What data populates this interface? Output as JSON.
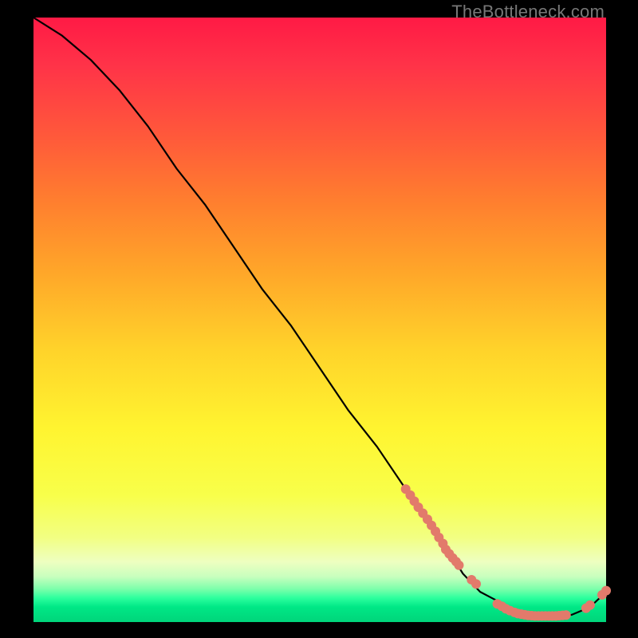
{
  "watermark": "TheBottleneck.com",
  "chart_data": {
    "type": "line",
    "title": "",
    "xlabel": "",
    "ylabel": "",
    "xlim": [
      0,
      100
    ],
    "ylim": [
      0,
      100
    ],
    "grid": false,
    "legend": false,
    "series": [
      {
        "name": "bottleneck-curve",
        "color": "#000000",
        "x": [
          0,
          5,
          10,
          15,
          20,
          25,
          30,
          35,
          40,
          45,
          50,
          55,
          60,
          65,
          67,
          70,
          73,
          75,
          78,
          80,
          83,
          85,
          88,
          90,
          92,
          94,
          96,
          98,
          100
        ],
        "y": [
          100,
          97,
          93,
          88,
          82,
          75,
          69,
          62,
          55,
          49,
          42,
          35,
          29,
          22,
          19,
          15,
          11,
          8,
          5,
          4,
          2.5,
          1.5,
          1,
          1,
          1,
          1.2,
          2,
          3.2,
          5
        ]
      }
    ],
    "markers": [
      {
        "name": "highlight-cluster-1",
        "color": "#e27a6b",
        "x": [
          65,
          65.8,
          66.5,
          67.2,
          68,
          68.8,
          69.5,
          70.2,
          70.8,
          71.5,
          72,
          72.6,
          73.2,
          73.8,
          74.3
        ],
        "y": [
          22,
          21,
          20,
          19,
          18,
          17,
          16,
          15,
          14,
          13,
          12,
          11.3,
          10.6,
          10,
          9.4
        ]
      },
      {
        "name": "highlight-cluster-2",
        "color": "#e27a6b",
        "x": [
          76.5,
          77.3
        ],
        "y": [
          7,
          6.3
        ]
      },
      {
        "name": "highlight-cluster-3",
        "color": "#e27a6b",
        "x": [
          81,
          81.8,
          82.5,
          83.2,
          84,
          84.6,
          85.2,
          85.8,
          86.4,
          87,
          87.6,
          88.2,
          88.8,
          89.4,
          90,
          90.6,
          91.2,
          91.8,
          92.4,
          93
        ],
        "y": [
          3,
          2.6,
          2.2,
          1.9,
          1.6,
          1.4,
          1.3,
          1.2,
          1.1,
          1.05,
          1,
          1,
          1,
          1,
          1,
          1,
          1,
          1.05,
          1.1,
          1.15
        ]
      },
      {
        "name": "highlight-cluster-4",
        "color": "#e27a6b",
        "x": [
          96.5,
          97.2,
          99.3,
          100
        ],
        "y": [
          2.3,
          2.8,
          4.5,
          5.2
        ]
      }
    ]
  }
}
